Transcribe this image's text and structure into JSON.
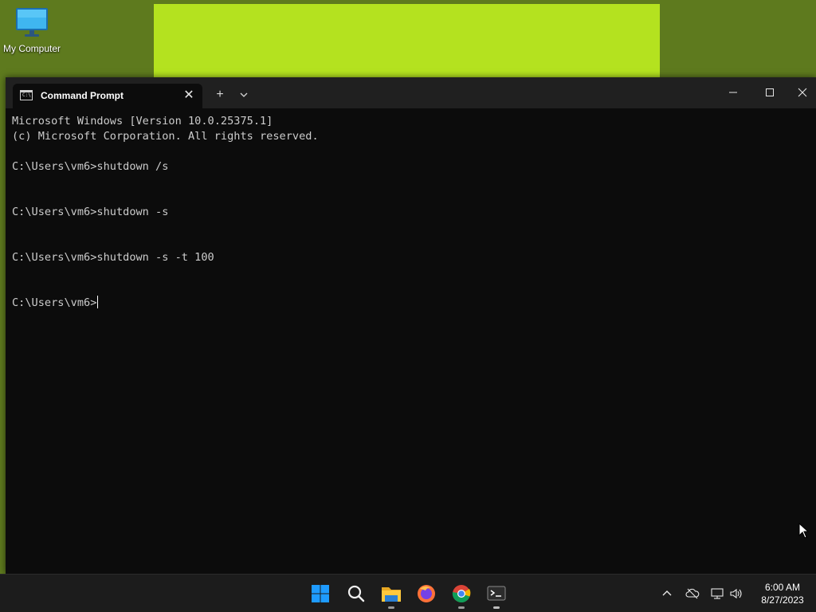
{
  "desktop": {
    "icons": [
      {
        "label": "My Computer",
        "icon": "computer-monitor-icon"
      }
    ]
  },
  "window": {
    "tab": {
      "title": "Command Prompt",
      "icon": "cmd-icon"
    },
    "new_tab_symbol": "+",
    "dropdown_symbol": "⌄",
    "controls": {
      "minimize": "—",
      "maximize": "☐",
      "close": "✕"
    }
  },
  "console": {
    "lines": [
      "Microsoft Windows [Version 10.0.25375.1]",
      "(c) Microsoft Corporation. All rights reserved.",
      "",
      "C:\\Users\\vm6>shutdown /s",
      "",
      "",
      "C:\\Users\\vm6>shutdown -s",
      "",
      "",
      "C:\\Users\\vm6>shutdown -s -t 100",
      "",
      ""
    ],
    "prompt": "C:\\Users\\vm6>"
  },
  "taskbar": {
    "apps": [
      {
        "name": "start",
        "icon": "windows-start-icon"
      },
      {
        "name": "search",
        "icon": "search-icon"
      },
      {
        "name": "file-explorer",
        "icon": "folder-icon"
      },
      {
        "name": "firefox",
        "icon": "firefox-icon"
      },
      {
        "name": "chrome",
        "icon": "chrome-icon"
      },
      {
        "name": "terminal",
        "icon": "terminal-icon"
      }
    ],
    "tray": {
      "chevron": "^",
      "time": "6:00 AM",
      "date": "8/27/2023"
    }
  },
  "colors": {
    "desktop_bg": "#5e7a1e",
    "desktop_patch": "#b4e21f",
    "terminal_bg": "#0c0c0c",
    "titlebar_bg": "#202020",
    "taskbar_bg": "#1c1c1c",
    "console_text": "#cccccc"
  }
}
